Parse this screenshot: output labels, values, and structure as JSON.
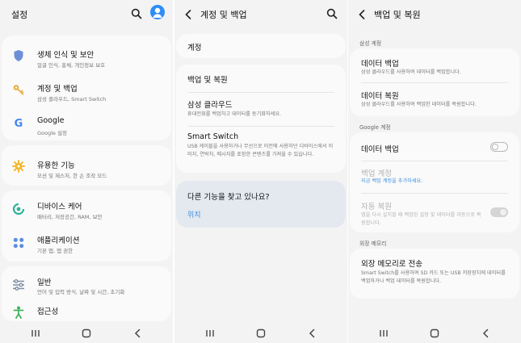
{
  "colors": {
    "screen_bg": "#f3f3f3",
    "card_bg": "#fafafa",
    "accent_blue": "#2f8df5",
    "link": "#3e8ede",
    "help_card_bg": "#e4e9ef"
  },
  "screen1": {
    "title": "설정",
    "items": [
      {
        "icon": "shield-icon",
        "title": "생체 인식 및 보안",
        "sub": "얼굴 인식, 홍채, 개인정보 보호"
      },
      {
        "icon": "key-icon",
        "title": "계정 및 백업",
        "sub": "삼성 클라우드, Smart Switch"
      },
      {
        "icon": "google-icon",
        "title": "Google",
        "sub": "Google 설정"
      },
      {
        "icon": "advanced-features-icon",
        "title": "유용한 기능",
        "sub": "모션 및 제스처, 한 손 조작 모드"
      },
      {
        "icon": "device-care-icon",
        "title": "디바이스 케어",
        "sub": "배터리, 저장공간, RAM, 보안"
      },
      {
        "icon": "apps-icon",
        "title": "애플리케이션",
        "sub": "기본 앱, 앱 권한"
      },
      {
        "icon": "general-management-icon",
        "title": "일반",
        "sub": "언어 및 입력 방식, 날짜 및 시간, 초기화"
      },
      {
        "icon": "accessibility-icon",
        "title": "접근성",
        "sub": ""
      }
    ]
  },
  "screen2": {
    "title": "계정 및 백업",
    "accounts": "계정",
    "backup_restore": "백업 및 복원",
    "samsung_cloud": {
      "title": "삼성 클라우드",
      "sub": "휴대전화를 백업하고 데이터를 동기화하세요."
    },
    "smart_switch": {
      "title": "Smart Switch",
      "sub": "USB 케이블을 사용하거나 무선으로 이전에 사용하던 디바이스에서 이미지, 연락처, 메시지를 포함한 콘텐츠를 가져올 수 있습니다."
    },
    "help": {
      "title": "다른 기능을 찾고 있나요?",
      "link": "위치"
    }
  },
  "screen3": {
    "title": "백업 및 복원",
    "samsung_section": "삼성 계정",
    "backup_data": {
      "title": "데이터 백업",
      "sub": "삼성 클라우드를 사용하여 데이터를 백업합니다."
    },
    "restore_data": {
      "title": "데이터 복원",
      "sub": "삼성 클라우드를 사용하여 백업한 데이터를 복원합니다."
    },
    "google_section": "Google 계정",
    "google_backup": {
      "title": "데이터 백업",
      "enabled": false
    },
    "backup_account": {
      "title": "백업 계정",
      "sub": "지금 백업 계정을 추가하세요."
    },
    "auto_restore": {
      "title": "자동 복원",
      "sub": "앱을 다시 설치할 때 백업된 설정 및 데이터를 자동으로 복원합니다.",
      "enabled": true
    },
    "external_section": "외장 메모리",
    "external_transfer": {
      "title": "외장 메모리로 전송",
      "sub": "Smart Switch를 사용하여 SD 카드 또는 USB 저장장치에 데이터를 백업하거나 백업 데이터를 복원합니다."
    }
  }
}
